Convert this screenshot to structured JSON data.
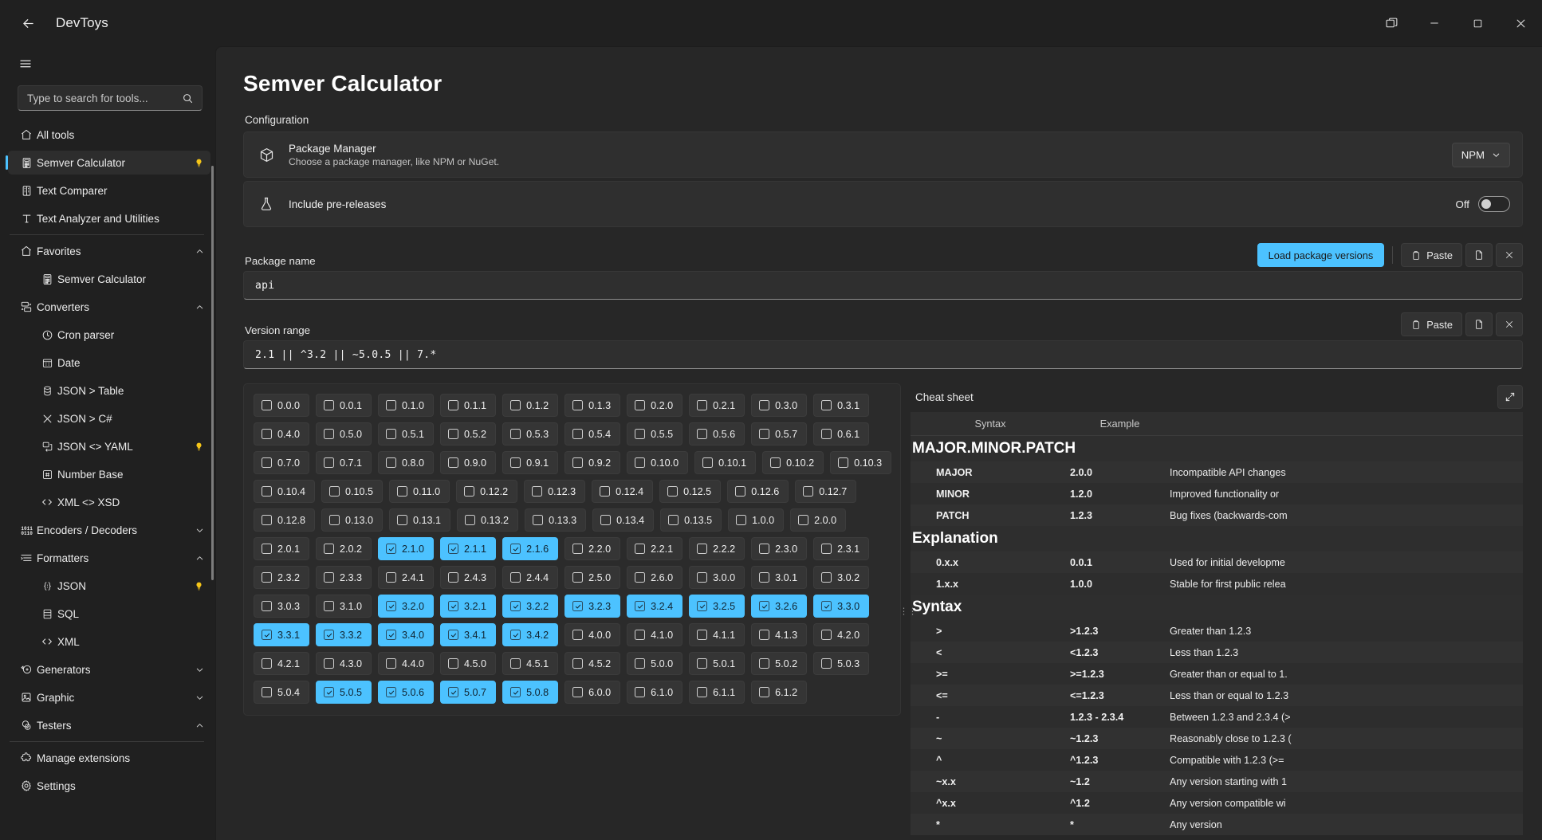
{
  "titlebar": {
    "back_icon": "back-arrow-icon",
    "title": "DevToys",
    "restore_down_icon": "multi-window-icon",
    "minimize_icon": "minimize-icon",
    "maximize_icon": "maximize-icon",
    "close_icon": "close-icon"
  },
  "sidebar": {
    "hamburger_icon": "hamburger-menu-icon",
    "search": {
      "placeholder": "Type to search for tools...",
      "value": "",
      "icon": "search-icon"
    },
    "items": [
      {
        "label": "All tools",
        "icon": "home-icon",
        "level": 0,
        "selected": false,
        "badge": "",
        "chevron": ""
      },
      {
        "label": "Semver Calculator",
        "icon": "calculator-icon",
        "level": 0,
        "selected": true,
        "badge": "bulb",
        "chevron": ""
      },
      {
        "label": "Text Comparer",
        "icon": "compare-icon",
        "level": 0,
        "selected": false,
        "badge": "",
        "chevron": ""
      },
      {
        "label": "Text Analyzer and Utilities",
        "icon": "text-icon",
        "level": 0,
        "selected": false,
        "badge": "",
        "chevron": ""
      },
      {
        "divider": true
      },
      {
        "label": "Favorites",
        "icon": "home-icon",
        "level": 0,
        "selected": false,
        "badge": "",
        "chevron": "up"
      },
      {
        "label": "Semver Calculator",
        "icon": "calculator-icon",
        "level": 1,
        "selected": false,
        "badge": "",
        "chevron": ""
      },
      {
        "label": "Converters",
        "icon": "converters-icon",
        "level": 0,
        "selected": false,
        "badge": "",
        "chevron": "up"
      },
      {
        "label": "Cron parser",
        "icon": "clock-icon",
        "level": 1,
        "selected": false,
        "badge": "",
        "chevron": ""
      },
      {
        "label": "Date",
        "icon": "calendar-icon",
        "level": 1,
        "selected": false,
        "badge": "",
        "chevron": ""
      },
      {
        "label": "JSON > Table",
        "icon": "database-icon",
        "level": 1,
        "selected": false,
        "badge": "",
        "chevron": ""
      },
      {
        "label": "JSON > C#",
        "icon": "transform-icon",
        "level": 1,
        "selected": false,
        "badge": "",
        "chevron": ""
      },
      {
        "label": "JSON <> YAML",
        "icon": "swap-icon",
        "level": 1,
        "selected": false,
        "badge": "bulb",
        "chevron": ""
      },
      {
        "label": "Number Base",
        "icon": "hash-box-icon",
        "level": 1,
        "selected": false,
        "badge": "",
        "chevron": ""
      },
      {
        "label": "XML <> XSD",
        "icon": "code-icon",
        "level": 1,
        "selected": false,
        "badge": "",
        "chevron": ""
      },
      {
        "label": "Encoders / Decoders",
        "icon": "binary-icon",
        "level": 0,
        "selected": false,
        "badge": "",
        "chevron": "down"
      },
      {
        "label": "Formatters",
        "icon": "formatters-icon",
        "level": 0,
        "selected": false,
        "badge": "",
        "chevron": "up"
      },
      {
        "label": "JSON",
        "icon": "braces-icon",
        "level": 1,
        "selected": false,
        "badge": "bulb",
        "chevron": ""
      },
      {
        "label": "SQL",
        "icon": "sql-icon",
        "level": 1,
        "selected": false,
        "badge": "",
        "chevron": ""
      },
      {
        "label": "XML",
        "icon": "code-icon",
        "level": 1,
        "selected": false,
        "badge": "",
        "chevron": ""
      },
      {
        "label": "Generators",
        "icon": "generators-icon",
        "level": 0,
        "selected": false,
        "badge": "",
        "chevron": "down"
      },
      {
        "label": "Graphic",
        "icon": "image-icon",
        "level": 0,
        "selected": false,
        "badge": "",
        "chevron": "down"
      },
      {
        "label": "Testers",
        "icon": "testers-icon",
        "level": 0,
        "selected": false,
        "badge": "",
        "chevron": "up"
      },
      {
        "divider": true
      },
      {
        "label": "Manage extensions",
        "icon": "puzzle-icon",
        "level": 0,
        "selected": false,
        "badge": "",
        "chevron": ""
      },
      {
        "label": "Settings",
        "icon": "gear-icon",
        "level": 0,
        "selected": false,
        "badge": "",
        "chevron": ""
      }
    ]
  },
  "main": {
    "page_title": "Semver Calculator",
    "configuration_label": "Configuration",
    "package_manager": {
      "icon": "package-icon",
      "title": "Package Manager",
      "subtitle": "Choose a package manager, like NPM or NuGet.",
      "selected": "NPM",
      "options": [
        "NPM",
        "NuGet"
      ]
    },
    "pre_releases": {
      "icon": "flask-icon",
      "title": "Include pre-releases",
      "toggle_state": "Off"
    },
    "package_name": {
      "label": "Package name",
      "value": "api",
      "load_button": "Load package versions",
      "paste_button": "Paste",
      "open_file_icon": "file-icon",
      "clear_icon": "close-icon"
    },
    "version_range": {
      "label": "Version range",
      "value": "2.1 || ^3.2 || ~5.0.5 || 7.*",
      "paste_button": "Paste",
      "open_file_icon": "file-icon",
      "clear_icon": "close-icon"
    },
    "versions": [
      {
        "v": "0.0.0",
        "on": false
      },
      {
        "v": "0.0.1",
        "on": false
      },
      {
        "v": "0.1.0",
        "on": false
      },
      {
        "v": "0.1.1",
        "on": false
      },
      {
        "v": "0.1.2",
        "on": false
      },
      {
        "v": "0.1.3",
        "on": false
      },
      {
        "v": "0.2.0",
        "on": false
      },
      {
        "v": "0.2.1",
        "on": false
      },
      {
        "v": "0.3.0",
        "on": false
      },
      {
        "v": "0.3.1",
        "on": false
      },
      {
        "v": "0.4.0",
        "on": false
      },
      {
        "v": "0.5.0",
        "on": false
      },
      {
        "v": "0.5.1",
        "on": false
      },
      {
        "v": "0.5.2",
        "on": false
      },
      {
        "v": "0.5.3",
        "on": false
      },
      {
        "v": "0.5.4",
        "on": false
      },
      {
        "v": "0.5.5",
        "on": false
      },
      {
        "v": "0.5.6",
        "on": false
      },
      {
        "v": "0.5.7",
        "on": false
      },
      {
        "v": "0.6.1",
        "on": false
      },
      {
        "v": "0.7.0",
        "on": false
      },
      {
        "v": "0.7.1",
        "on": false
      },
      {
        "v": "0.8.0",
        "on": false
      },
      {
        "v": "0.9.0",
        "on": false
      },
      {
        "v": "0.9.1",
        "on": false
      },
      {
        "v": "0.9.2",
        "on": false
      },
      {
        "v": "0.10.0",
        "on": false
      },
      {
        "v": "0.10.1",
        "on": false
      },
      {
        "v": "0.10.2",
        "on": false
      },
      {
        "v": "0.10.3",
        "on": false
      },
      {
        "v": "0.10.4",
        "on": false
      },
      {
        "v": "0.10.5",
        "on": false
      },
      {
        "v": "0.11.0",
        "on": false
      },
      {
        "v": "0.12.2",
        "on": false
      },
      {
        "v": "0.12.3",
        "on": false
      },
      {
        "v": "0.12.4",
        "on": false
      },
      {
        "v": "0.12.5",
        "on": false
      },
      {
        "v": "0.12.6",
        "on": false
      },
      {
        "v": "0.12.7",
        "on": false
      },
      {
        "v": "0.12.8",
        "on": false
      },
      {
        "v": "0.13.0",
        "on": false
      },
      {
        "v": "0.13.1",
        "on": false
      },
      {
        "v": "0.13.2",
        "on": false
      },
      {
        "v": "0.13.3",
        "on": false
      },
      {
        "v": "0.13.4",
        "on": false
      },
      {
        "v": "0.13.5",
        "on": false
      },
      {
        "v": "1.0.0",
        "on": false
      },
      {
        "v": "2.0.0",
        "on": false
      },
      {
        "v": "2.0.1",
        "on": false
      },
      {
        "v": "2.0.2",
        "on": false
      },
      {
        "v": "2.1.0",
        "on": true
      },
      {
        "v": "2.1.1",
        "on": true
      },
      {
        "v": "2.1.6",
        "on": true
      },
      {
        "v": "2.2.0",
        "on": false
      },
      {
        "v": "2.2.1",
        "on": false
      },
      {
        "v": "2.2.2",
        "on": false
      },
      {
        "v": "2.3.0",
        "on": false
      },
      {
        "v": "2.3.1",
        "on": false
      },
      {
        "v": "2.3.2",
        "on": false
      },
      {
        "v": "2.3.3",
        "on": false
      },
      {
        "v": "2.4.1",
        "on": false
      },
      {
        "v": "2.4.3",
        "on": false
      },
      {
        "v": "2.4.4",
        "on": false
      },
      {
        "v": "2.5.0",
        "on": false
      },
      {
        "v": "2.6.0",
        "on": false
      },
      {
        "v": "3.0.0",
        "on": false
      },
      {
        "v": "3.0.1",
        "on": false
      },
      {
        "v": "3.0.2",
        "on": false
      },
      {
        "v": "3.0.3",
        "on": false
      },
      {
        "v": "3.1.0",
        "on": false
      },
      {
        "v": "3.2.0",
        "on": true
      },
      {
        "v": "3.2.1",
        "on": true
      },
      {
        "v": "3.2.2",
        "on": true
      },
      {
        "v": "3.2.3",
        "on": true
      },
      {
        "v": "3.2.4",
        "on": true
      },
      {
        "v": "3.2.5",
        "on": true
      },
      {
        "v": "3.2.6",
        "on": true
      },
      {
        "v": "3.3.0",
        "on": true
      },
      {
        "v": "3.3.1",
        "on": true
      },
      {
        "v": "3.3.2",
        "on": true
      },
      {
        "v": "3.4.0",
        "on": true
      },
      {
        "v": "3.4.1",
        "on": true
      },
      {
        "v": "3.4.2",
        "on": true
      },
      {
        "v": "4.0.0",
        "on": false
      },
      {
        "v": "4.1.0",
        "on": false
      },
      {
        "v": "4.1.1",
        "on": false
      },
      {
        "v": "4.1.3",
        "on": false
      },
      {
        "v": "4.2.0",
        "on": false
      },
      {
        "v": "4.2.1",
        "on": false
      },
      {
        "v": "4.3.0",
        "on": false
      },
      {
        "v": "4.4.0",
        "on": false
      },
      {
        "v": "4.5.0",
        "on": false
      },
      {
        "v": "4.5.1",
        "on": false
      },
      {
        "v": "4.5.2",
        "on": false
      },
      {
        "v": "5.0.0",
        "on": false
      },
      {
        "v": "5.0.1",
        "on": false
      },
      {
        "v": "5.0.2",
        "on": false
      },
      {
        "v": "5.0.3",
        "on": false
      },
      {
        "v": "5.0.4",
        "on": false
      },
      {
        "v": "5.0.5",
        "on": true
      },
      {
        "v": "5.0.6",
        "on": true
      },
      {
        "v": "5.0.7",
        "on": true
      },
      {
        "v": "5.0.8",
        "on": true
      },
      {
        "v": "6.0.0",
        "on": false
      },
      {
        "v": "6.1.0",
        "on": false
      },
      {
        "v": "6.1.1",
        "on": false
      },
      {
        "v": "6.1.2",
        "on": false
      }
    ]
  },
  "cheat_sheet": {
    "title": "Cheat sheet",
    "expand_icon": "expand-icon",
    "columns": [
      "Syntax",
      "Example",
      ""
    ],
    "sections": [
      {
        "heading": "MAJOR.MINOR.PATCH",
        "rows": [
          {
            "syntax": "MAJOR",
            "example": "2.0.0",
            "description": "Incompatible API changes"
          },
          {
            "syntax": "MINOR",
            "example": "1.2.0",
            "description": "Improved functionality or"
          },
          {
            "syntax": "PATCH",
            "example": "1.2.3",
            "description": "Bug fixes (backwards-com"
          }
        ]
      },
      {
        "heading": "Explanation",
        "rows": [
          {
            "syntax": "0.x.x",
            "example": "0.0.1",
            "description": "Used for initial developme"
          },
          {
            "syntax": "1.x.x",
            "example": "1.0.0",
            "description": "Stable for first public relea"
          }
        ]
      },
      {
        "heading": "Syntax",
        "rows": [
          {
            "syntax": ">",
            "example": ">1.2.3",
            "description": "Greater than 1.2.3"
          },
          {
            "syntax": "<",
            "example": "<1.2.3",
            "description": "Less than 1.2.3"
          },
          {
            "syntax": ">=",
            "example": ">=1.2.3",
            "description": "Greater than or equal to 1."
          },
          {
            "syntax": "<=",
            "example": "<=1.2.3",
            "description": "Less than or equal to 1.2.3"
          },
          {
            "syntax": "-",
            "example": "1.2.3 - 2.3.4",
            "description": "Between 1.2.3 and 2.3.4 (>"
          },
          {
            "syntax": "~",
            "example": "~1.2.3",
            "description": "Reasonably close to 1.2.3 ("
          },
          {
            "syntax": "^",
            "example": "^1.2.3",
            "description": "Compatible with 1.2.3 (>="
          },
          {
            "syntax": "~x.x",
            "example": "~1.2",
            "description": "Any version starting with 1"
          },
          {
            "syntax": "^x.x",
            "example": "^1.2",
            "description": "Any version compatible wi"
          },
          {
            "syntax": "*",
            "example": "*",
            "description": "Any version"
          }
        ]
      }
    ]
  },
  "colors": {
    "accent": "#4cc2ff",
    "bulb": "#f5c518",
    "bg": "#202020",
    "panel": "#2b2b2b"
  }
}
